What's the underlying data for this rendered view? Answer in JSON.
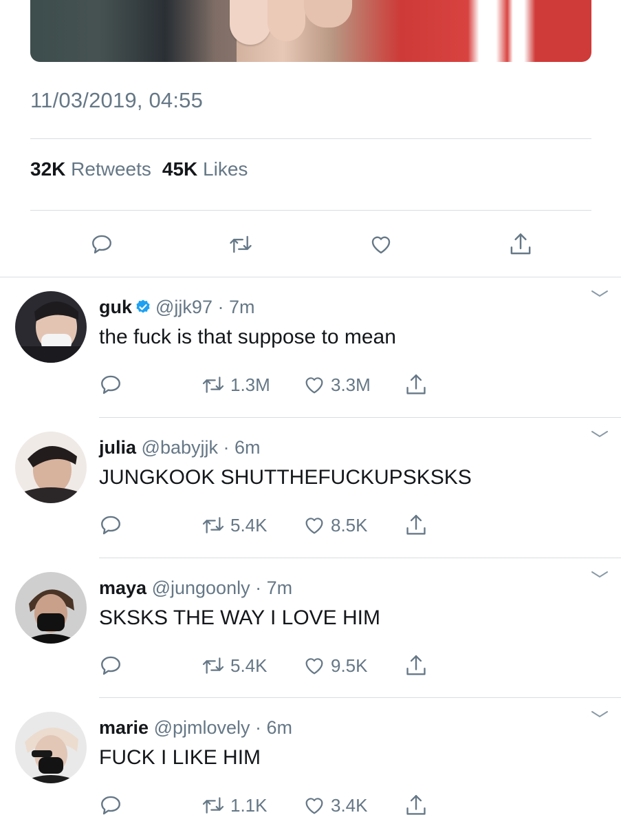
{
  "tweet": {
    "timestamp": "11/03/2019, 04:55",
    "retweets_count": "32K",
    "retweets_label": "Retweets",
    "likes_count": "45K",
    "likes_label": "Likes"
  },
  "colors": {
    "text": "#14171a",
    "muted": "#657786",
    "divider": "#d9dde1",
    "verified": "#1da1f2"
  },
  "icons": {
    "reply": "reply-icon",
    "retweet": "retweet-icon",
    "like": "heart-icon",
    "share": "share-icon",
    "verified": "verified-badge-icon",
    "more": "chevron-down-icon"
  },
  "replies": [
    {
      "name": "guk",
      "verified": true,
      "handle": "@jjk97",
      "time": "7m",
      "text": "the fuck is that suppose to mean",
      "retweets": "1.3M",
      "likes": "3.3M"
    },
    {
      "name": "julia",
      "verified": false,
      "handle": "@babyjjk",
      "time": "6m",
      "text": "JUNGKOOK SHUTTHEFUCKUPSKSKS",
      "retweets": "5.4K",
      "likes": "8.5K"
    },
    {
      "name": "maya",
      "verified": false,
      "handle": "@jungoonly",
      "time": "7m",
      "text": "SKSKS THE WAY I LOVE HIM",
      "retweets": "5.4K",
      "likes": "9.5K"
    },
    {
      "name": "marie",
      "verified": false,
      "handle": "@pjmlovely",
      "time": "6m",
      "text": "FUCK I LIKE HIM",
      "retweets": "1.1K",
      "likes": "3.4K"
    }
  ]
}
